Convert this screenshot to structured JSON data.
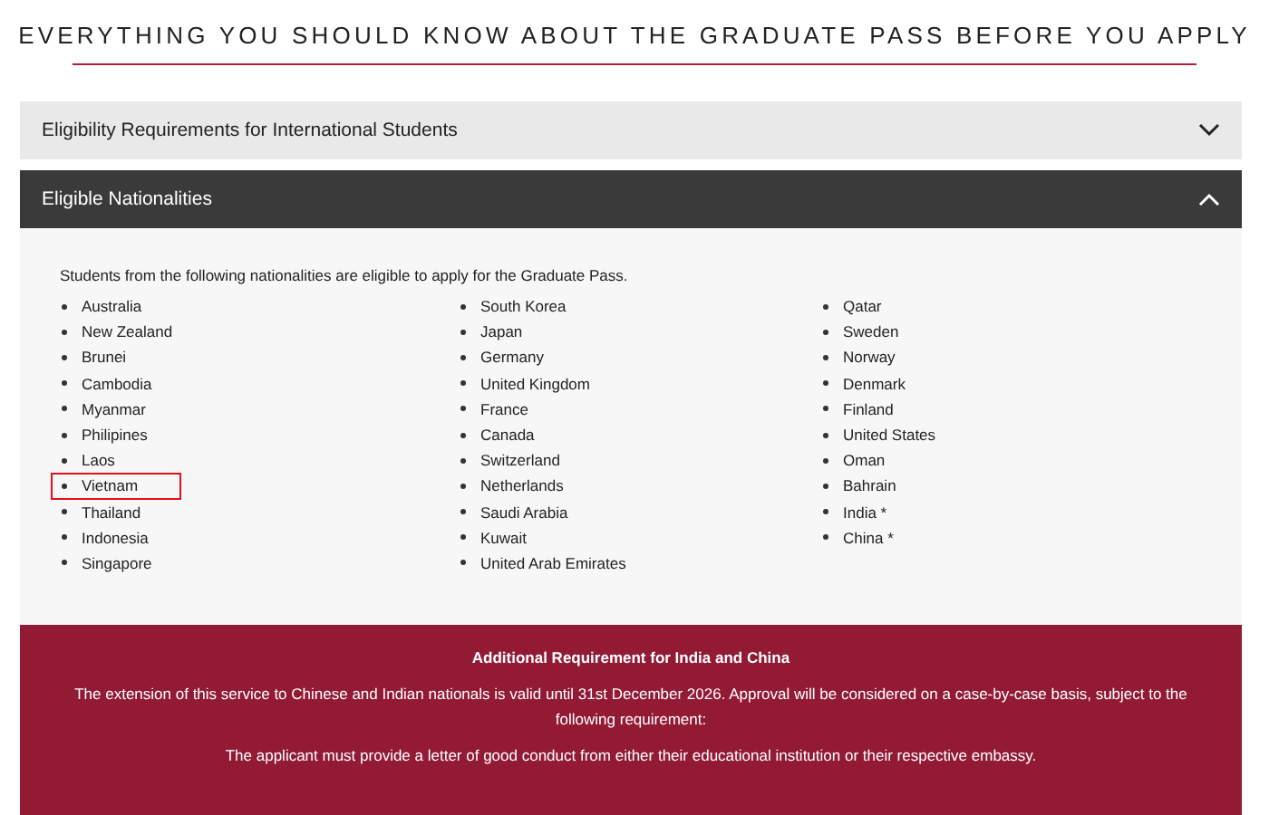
{
  "heading": "EVERYTHING YOU SHOULD KNOW ABOUT THE GRADUATE PASS BEFORE YOU APPLY",
  "sections": [
    {
      "title": "Eligibility Requirements for International Students",
      "expanded": false
    },
    {
      "title": "Eligible Nationalities",
      "expanded": true
    }
  ],
  "intro": "Students from the following nationalities are eligible to apply for the Graduate Pass.",
  "columns": [
    [
      {
        "name": "Australia",
        "highlighted": false
      },
      {
        "name": "New Zealand",
        "highlighted": false
      },
      {
        "name": "Brunei",
        "highlighted": false
      },
      {
        "name": "Cambodia",
        "highlighted": false
      },
      {
        "name": "Myanmar",
        "highlighted": false
      },
      {
        "name": "Philipines",
        "highlighted": false
      },
      {
        "name": "Laos",
        "highlighted": false
      },
      {
        "name": "Vietnam",
        "highlighted": true
      },
      {
        "name": "Thailand",
        "highlighted": false
      },
      {
        "name": "Indonesia",
        "highlighted": false
      },
      {
        "name": "Singapore",
        "highlighted": false
      }
    ],
    [
      {
        "name": "South Korea",
        "highlighted": false
      },
      {
        "name": "Japan",
        "highlighted": false
      },
      {
        "name": "Germany",
        "highlighted": false
      },
      {
        "name": "United Kingdom",
        "highlighted": false
      },
      {
        "name": "France",
        "highlighted": false
      },
      {
        "name": "Canada",
        "highlighted": false
      },
      {
        "name": "Switzerland",
        "highlighted": false
      },
      {
        "name": "Netherlands",
        "highlighted": false
      },
      {
        "name": "Saudi Arabia",
        "highlighted": false
      },
      {
        "name": "Kuwait",
        "highlighted": false
      },
      {
        "name": "United Arab Emirates",
        "highlighted": false
      }
    ],
    [
      {
        "name": "Qatar",
        "highlighted": false
      },
      {
        "name": "Sweden",
        "highlighted": false
      },
      {
        "name": "Norway",
        "highlighted": false
      },
      {
        "name": "Denmark",
        "highlighted": false
      },
      {
        "name": "Finland",
        "highlighted": false
      },
      {
        "name": "United States",
        "highlighted": false
      },
      {
        "name": "Oman",
        "highlighted": false
      },
      {
        "name": "Bahrain",
        "highlighted": false
      },
      {
        "name": "India *",
        "highlighted": false
      },
      {
        "name": "China *",
        "highlighted": false
      }
    ]
  ],
  "notice": {
    "title": "Additional Requirement for India and China",
    "paragraphs": [
      "The extension of this service to Chinese and Indian nationals is valid until 31st December 2026. Approval will be considered on a case-by-case basis, subject to the following requirement:",
      "The applicant must provide a letter of good conduct from either their educational institution or their respective embassy."
    ]
  }
}
